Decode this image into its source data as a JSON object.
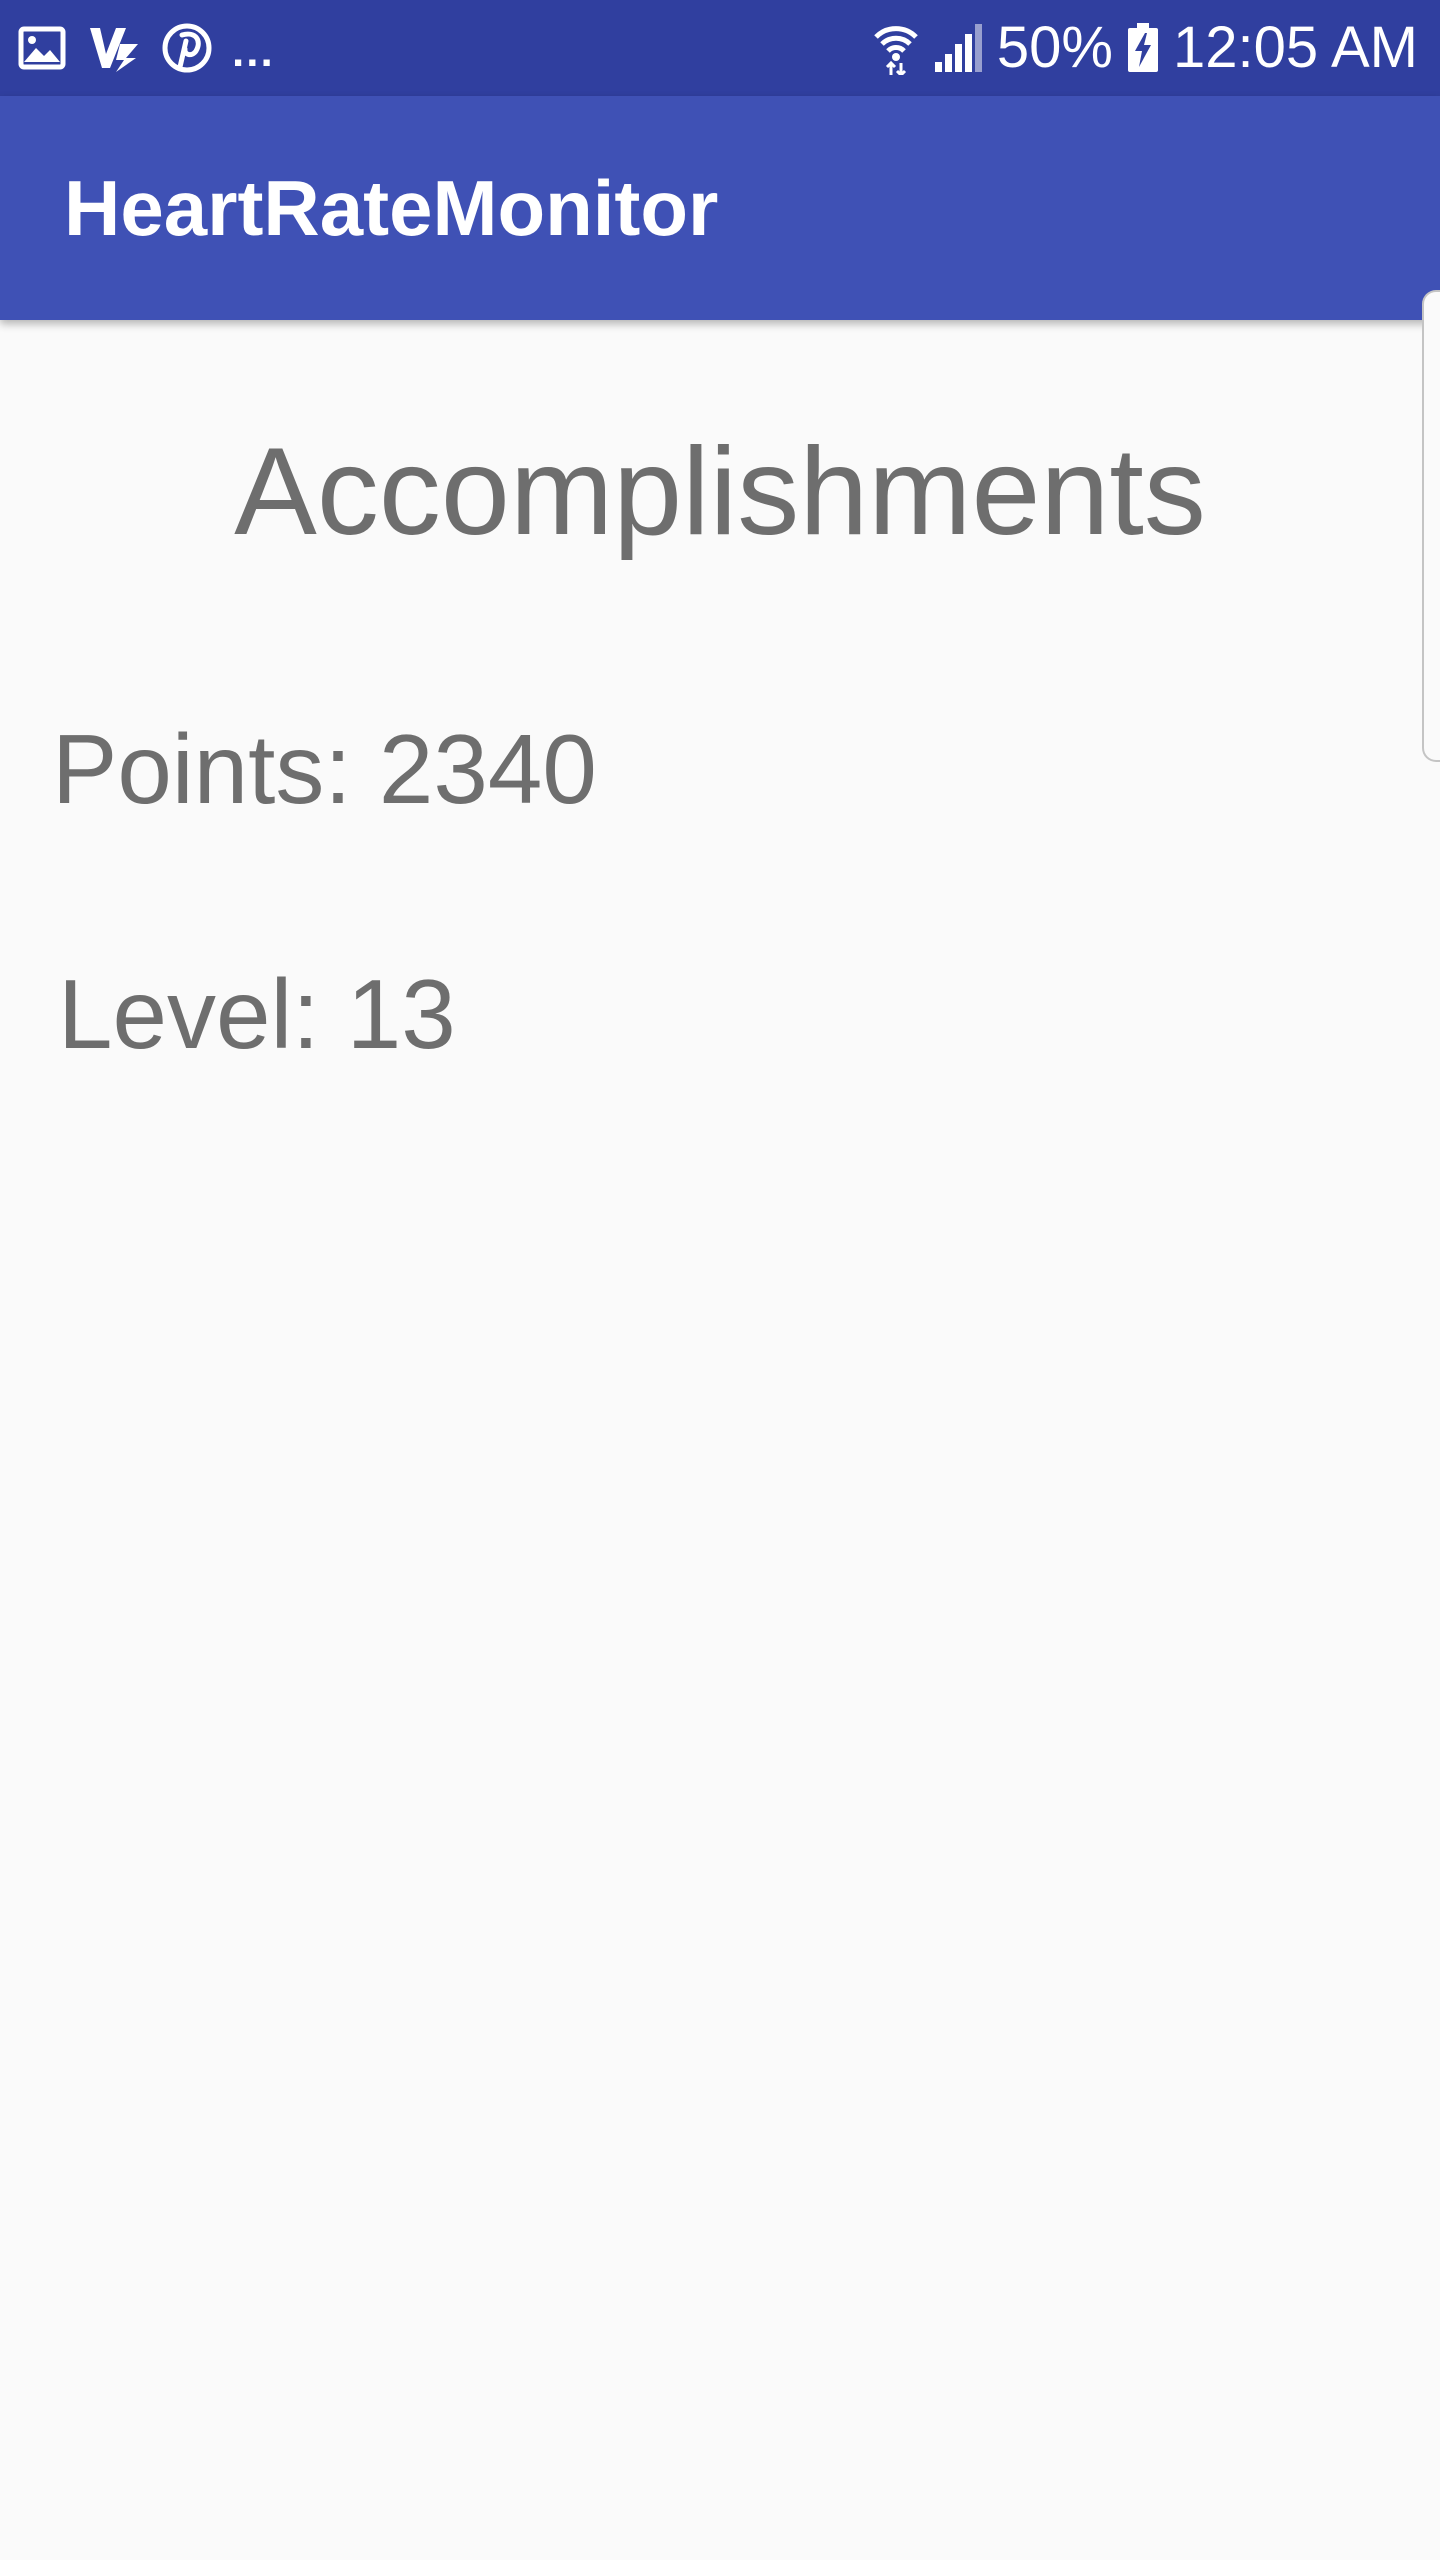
{
  "status_bar": {
    "left_icons": [
      "image-icon",
      "v-logo-icon",
      "pinterest-icon"
    ],
    "more": "...",
    "battery_percent": "50%",
    "time": "12:05 AM",
    "right_icons": [
      "wifi-icon",
      "cell-signal-icon",
      "battery-charging-icon"
    ]
  },
  "app_bar": {
    "title": "HeartRateMonitor"
  },
  "main": {
    "heading": "Accomplishments",
    "points": "Points: 2340",
    "level": "Level: 13"
  },
  "colors": {
    "status_bar": "#303f9f",
    "app_bar": "#3f51b5",
    "background": "#fafafa",
    "text": "#6e6e6e"
  }
}
